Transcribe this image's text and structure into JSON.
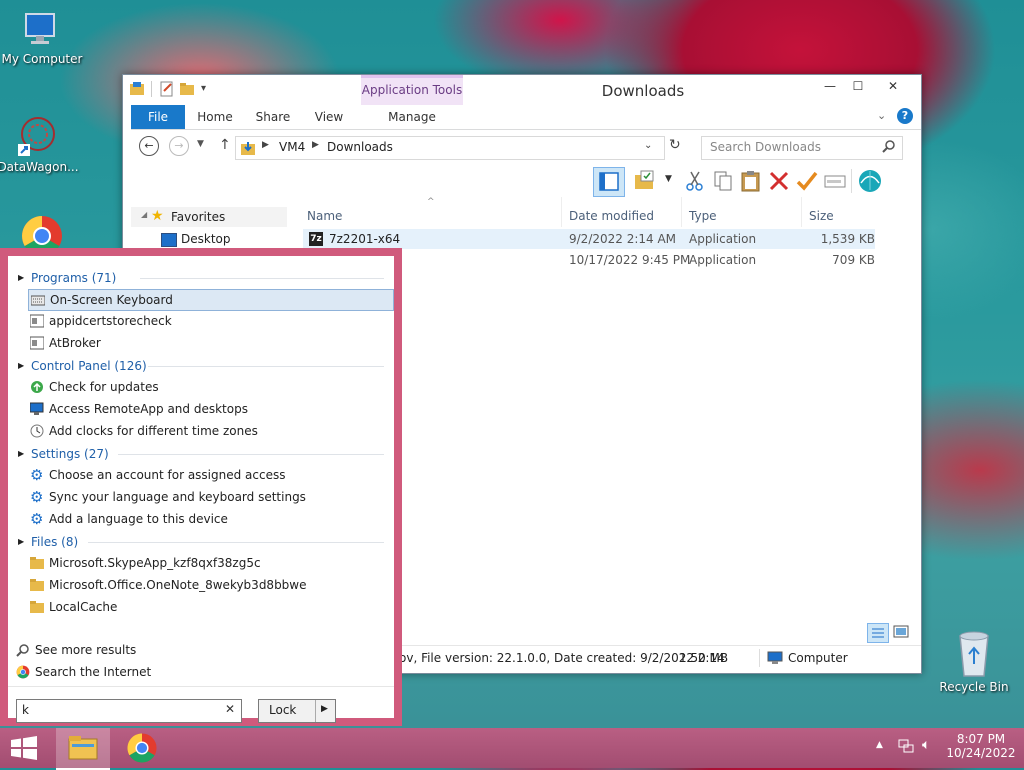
{
  "desktop": {
    "icons": [
      {
        "label": "My Computer"
      },
      {
        "label": "DataWagon..."
      },
      {
        "label": "Recycle Bin"
      }
    ]
  },
  "explorer": {
    "title": "Downloads",
    "ribbon": {
      "file": "File",
      "home": "Home",
      "share": "Share",
      "view": "View",
      "app_tools": "Application Tools",
      "manage": "Manage"
    },
    "breadcrumb": [
      "VM4",
      "Downloads"
    ],
    "search_placeholder": "Search Downloads",
    "nav": {
      "favorites": "Favorites",
      "desktop": "Desktop"
    },
    "columns": {
      "name": "Name",
      "date": "Date modified",
      "type": "Type",
      "size": "Size"
    },
    "files": [
      {
        "name": "7z2201-x64",
        "date": "9/2/2022 2:14 AM",
        "type": "Application",
        "size": "1,539 KB"
      },
      {
        "name": "",
        "date": "10/17/2022 9:45 PM",
        "type": "Application",
        "size": "709 KB"
      }
    ],
    "status": {
      "details": "ov, File version: 22.1.0.0, Date created: 9/2/2022 2:14",
      "size": "1.50 MB",
      "location": "Computer"
    }
  },
  "search_panel": {
    "groups": [
      {
        "label": "Programs (71)",
        "items": [
          "On-Screen Keyboard",
          "appidcertstorecheck",
          "AtBroker"
        ]
      },
      {
        "label": "Control Panel (126)",
        "items": [
          "Check for updates",
          "Access RemoteApp and desktops",
          "Add clocks for different time zones"
        ]
      },
      {
        "label": "Settings (27)",
        "items": [
          "Choose an account for assigned access",
          "Sync your language and keyboard settings",
          "Add a language to this device"
        ]
      },
      {
        "label": "Files (8)",
        "items": [
          "Microsoft.SkypeApp_kzf8qxf38zg5c",
          "Microsoft.Office.OneNote_8wekyb3d8bbwe",
          "LocalCache"
        ]
      }
    ],
    "see_more": "See more results",
    "search_internet": "Search the Internet",
    "query": "k",
    "lock_label": "Lock"
  },
  "taskbar": {
    "time": "8:07 PM",
    "date": "10/24/2022"
  },
  "colors": {
    "accent": "#1979ca",
    "panel_border": "#d05a7c",
    "taskbar": "#a24d71"
  }
}
